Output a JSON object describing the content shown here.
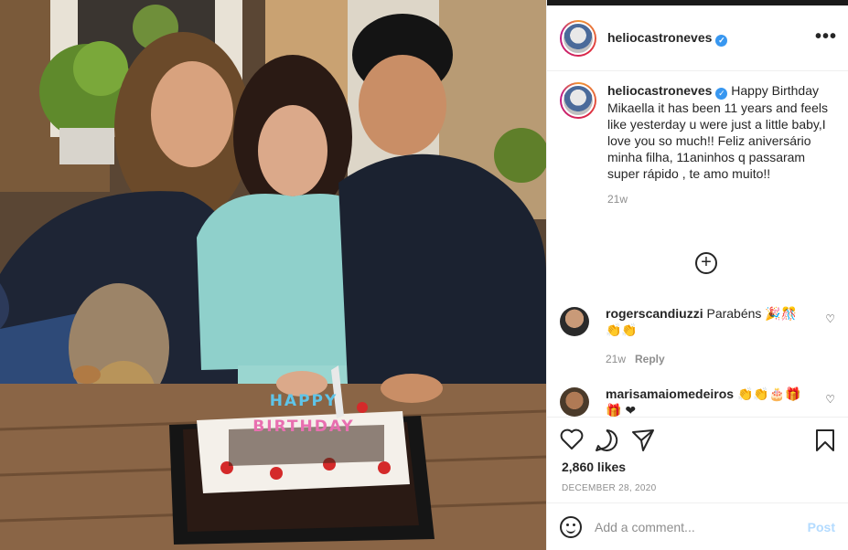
{
  "post": {
    "username": "heliocastroneves",
    "more_label": "•••",
    "caption_user": "heliocastroneves",
    "caption": "Happy Birthday Mikaella it has been 11 years and feels like yesterday u were just a little baby,I love you so much!! Feliz aniversário minha filha, 11aninhos q passaram super rápido , te amo muito!!",
    "caption_time": "21w",
    "load_more": "⊕",
    "comments": [
      {
        "user": "rogerscandiuzzi",
        "text": "Parabéns 🎉🎊 👏👏",
        "time": "21w",
        "reply": "Reply"
      },
      {
        "user": "marisamaiomedeiros",
        "text": "👏👏🎂🎁🎁 ❤",
        "time": "",
        "reply": ""
      }
    ],
    "likes": "2,860 likes",
    "date": "DECEMBER 28, 2020",
    "comment_placeholder": "Add a comment...",
    "post_button": "Post"
  },
  "photo": {
    "cake_text_line1": "HAPPY",
    "cake_text_line2": "BIRTHDAY"
  },
  "colors": {
    "verified": "#3897f0",
    "post_button": "#b3dbff"
  }
}
